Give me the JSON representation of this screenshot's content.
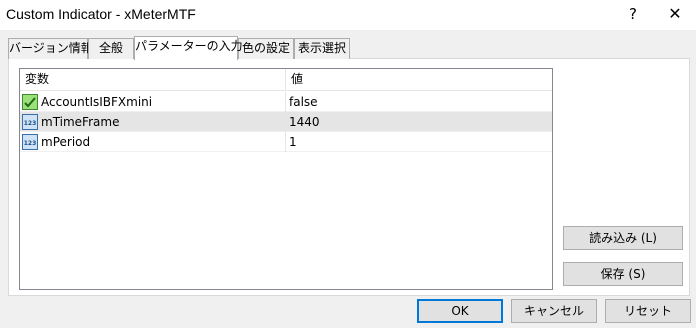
{
  "window": {
    "title": "Custom Indicator - xMeterMTF",
    "help_glyph": "?",
    "close_glyph": "✕"
  },
  "tabs": [
    {
      "label": "バージョン情報"
    },
    {
      "label": "全般"
    },
    {
      "label": "パラメーターの入力"
    },
    {
      "label": "色の設定"
    },
    {
      "label": "表示選択"
    }
  ],
  "active_tab": 2,
  "grid": {
    "columns": [
      "変数",
      "値"
    ],
    "rows": [
      {
        "name": "AccountIsIBFXmini",
        "value": "false",
        "icon": "boolean-icon"
      },
      {
        "name": "mTimeFrame",
        "value": "1440",
        "icon": "integer-icon"
      },
      {
        "name": "mPeriod",
        "value": "1",
        "icon": "integer-icon"
      }
    ],
    "selected_row": 1
  },
  "side_buttons": {
    "load": "読み込み (L)",
    "save": "保存 (S)"
  },
  "footer_buttons": {
    "ok": "OK",
    "cancel": "キャンセル",
    "reset": "リセット"
  },
  "colors": {
    "accent": "#0078d7",
    "selected_row": "#e5e5e5"
  }
}
